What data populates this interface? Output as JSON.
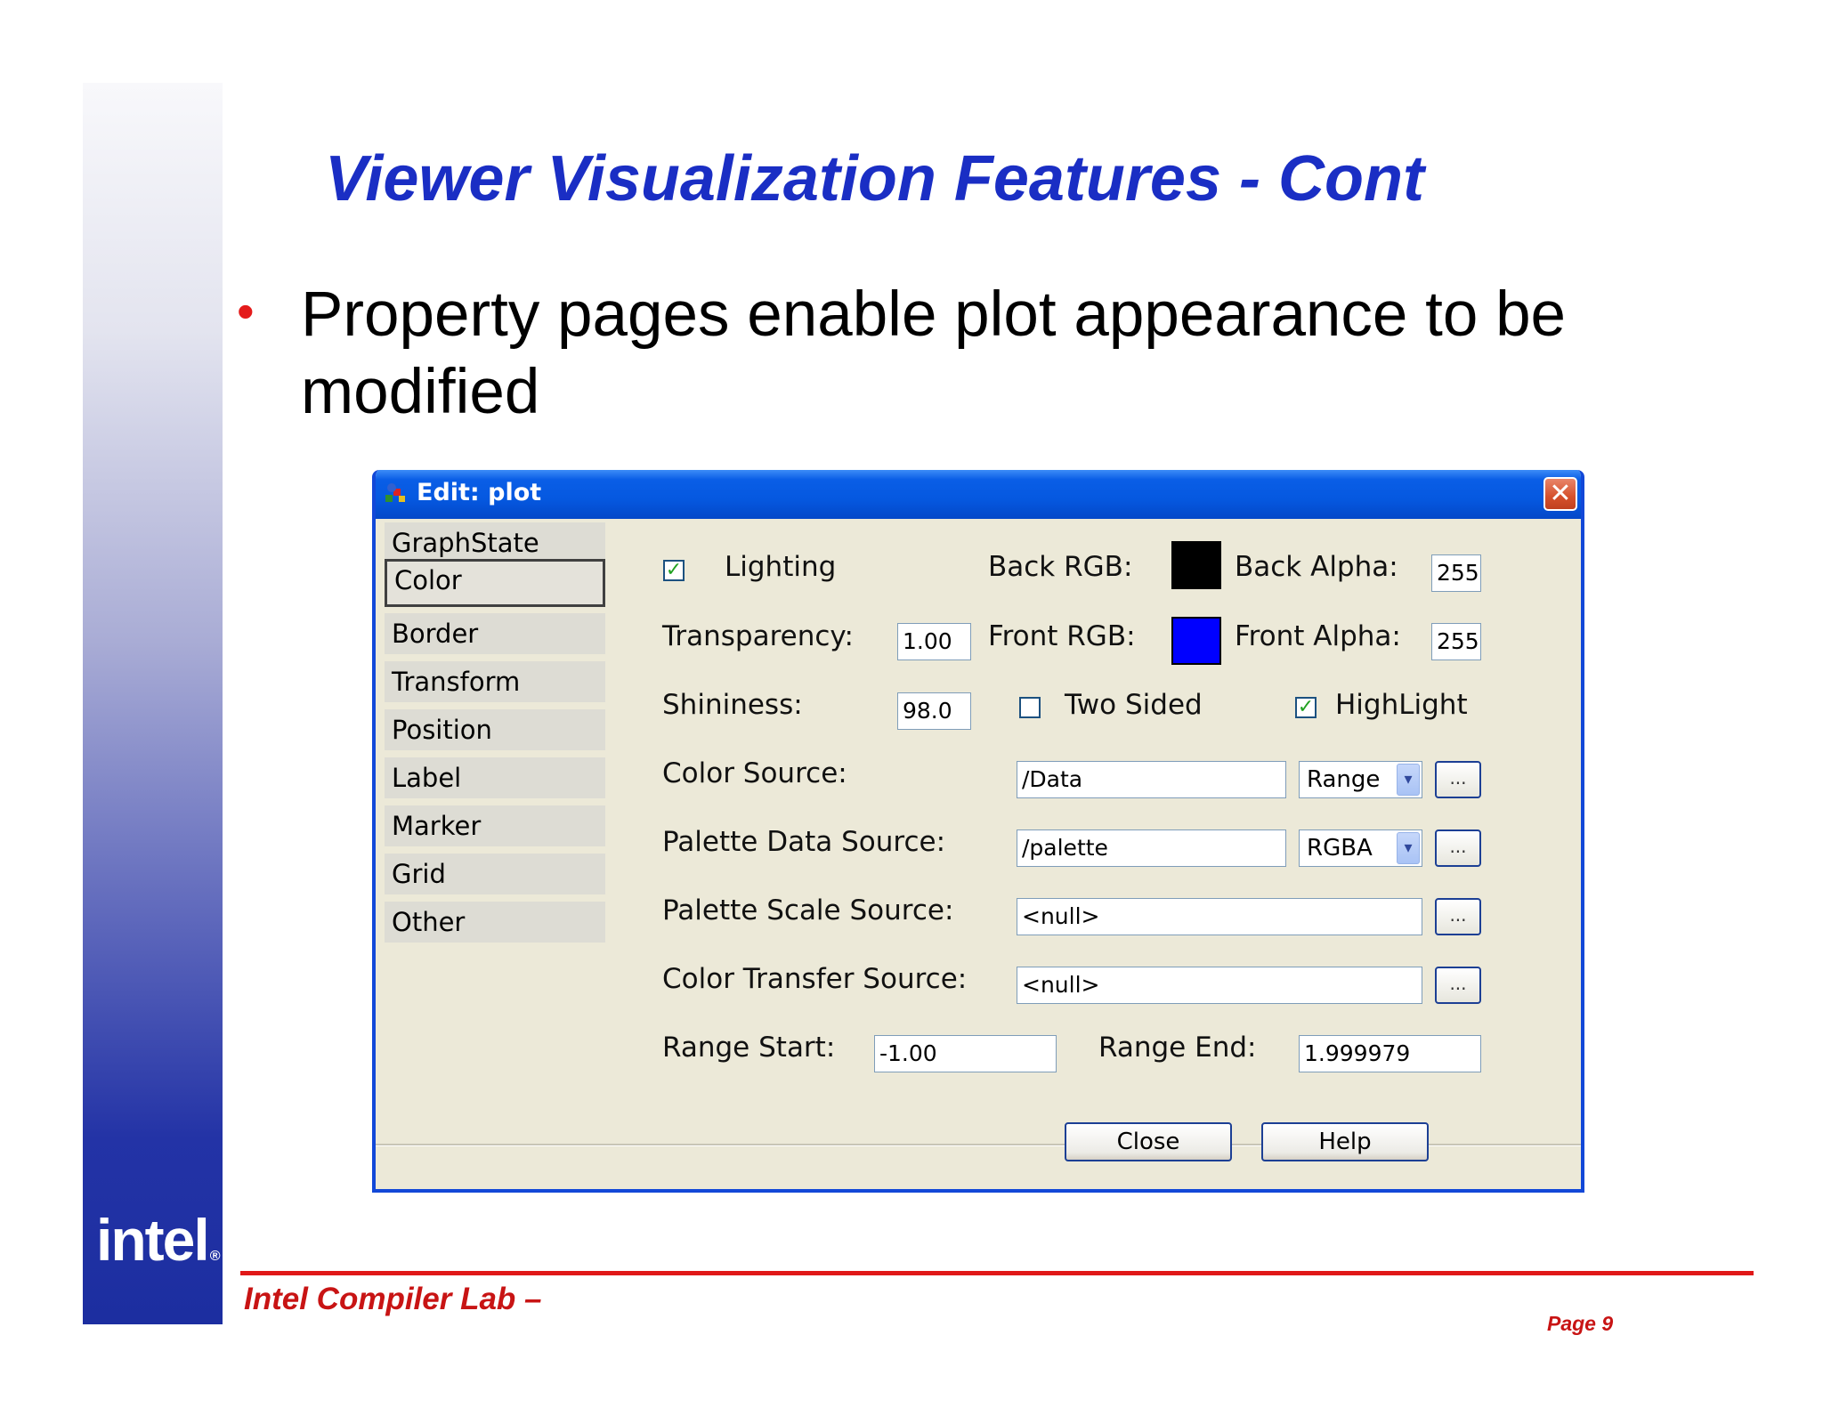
{
  "slide": {
    "title": "Viewer Visualization Features - Cont",
    "bullet": "Property pages enable plot appearance to be modified",
    "footer": "Intel Compiler Lab –",
    "page": "Page 9",
    "logo": "intel"
  },
  "dialog": {
    "title": "Edit: plot",
    "close_icon": "✕",
    "nav": [
      "GraphState",
      "Color",
      "Border",
      "Transform",
      "Position",
      "Label",
      "Marker",
      "Grid",
      "Other"
    ],
    "selected_nav": "Color",
    "lighting": {
      "label": "Lighting",
      "checked": true
    },
    "back_rgb": {
      "label": "Back RGB:",
      "color": "#000000"
    },
    "back_alpha": {
      "label": "Back Alpha:",
      "value": "255"
    },
    "transparency": {
      "label": "Transparency:",
      "value": "1.00"
    },
    "front_rgb": {
      "label": "Front RGB:",
      "color": "#0000ff"
    },
    "front_alpha": {
      "label": "Front Alpha:",
      "value": "255"
    },
    "shininess": {
      "label": "Shininess:",
      "value": "98.0"
    },
    "two_sided": {
      "label": "Two Sided",
      "checked": false
    },
    "highlight": {
      "label": "HighLight",
      "checked": true
    },
    "color_source": {
      "label": "Color Source:",
      "value": "/Data",
      "mode": "Range"
    },
    "palette_data_source": {
      "label": "Palette Data Source:",
      "value": "/palette",
      "mode": "RGBA"
    },
    "palette_scale_source": {
      "label": "Palette Scale Source:",
      "value": "<null>"
    },
    "color_transfer_source": {
      "label": "Color Transfer Source:",
      "value": "<null>"
    },
    "range_start": {
      "label": "Range Start:",
      "value": "-1.00"
    },
    "range_end": {
      "label": "Range End:",
      "value": "1.999979"
    },
    "browse_label": "...",
    "check_mark": "✓",
    "dropdown_icon": "▾",
    "buttons": {
      "close": "Close",
      "help": "Help"
    }
  }
}
